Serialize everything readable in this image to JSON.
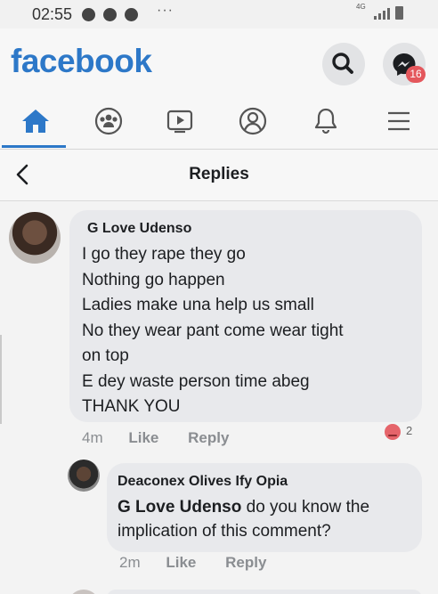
{
  "status_bar": {
    "time": "02:55",
    "dots": "···",
    "network": "4G"
  },
  "header": {
    "logo": "facebook",
    "notification_count": "16"
  },
  "nav": {
    "tabs": [
      "home-icon",
      "groups-icon",
      "watch-icon",
      "profile-icon",
      "notifications-icon",
      "menu-icon"
    ],
    "active": "home-icon",
    "accent_color": "#2d78c8"
  },
  "page": {
    "title": "Replies"
  },
  "comment": {
    "author": "G Love Udenso",
    "lines": [
      " I go they rape they go",
      "Nothing go happen",
      "Ladies make una help us  small",
      "No they wear pant come wear tight",
      "on top",
      "E dey waste person time abeg",
      "THANK YOU"
    ],
    "time": "4m",
    "like_label": "Like",
    "reply_label": "Reply",
    "reaction_count": "2"
  },
  "reply": {
    "author": "Deaconex Olives Ify Opia",
    "mention": "G Love Udenso",
    "text_line1": " do you know the",
    "text_line2": "implication of this comment?",
    "time": "2m",
    "like_label": "Like",
    "reply_label": "Reply"
  }
}
